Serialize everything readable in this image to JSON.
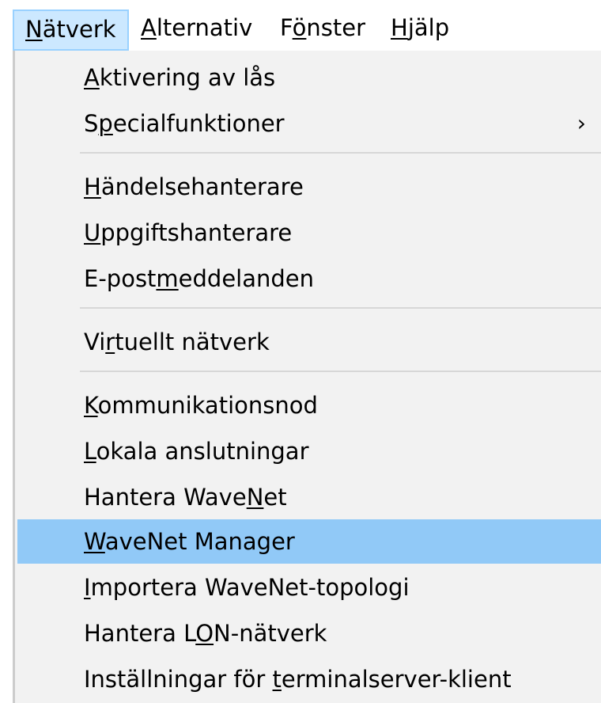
{
  "menubar": {
    "items": [
      {
        "pre": "",
        "key": "N",
        "post": "ätverk"
      },
      {
        "pre": "",
        "key": "A",
        "post": "lternativ"
      },
      {
        "pre": "F",
        "key": "ö",
        "post": "nster"
      },
      {
        "pre": "",
        "key": "H",
        "post": "jälp"
      }
    ]
  },
  "menu": {
    "items": [
      {
        "pre": "",
        "key": "A",
        "post": "ktivering av lås"
      },
      {
        "pre": "S",
        "key": "p",
        "post": "ecialfunktioner",
        "submenu": "›"
      },
      {
        "pre": "",
        "key": "H",
        "post": "ändelsehanterare"
      },
      {
        "pre": "",
        "key": "U",
        "post": "ppgiftshanterare"
      },
      {
        "pre": "E-post",
        "key": "m",
        "post": "eddelanden"
      },
      {
        "pre": "Vi",
        "key": "r",
        "post": "tuellt nätverk"
      },
      {
        "pre": "",
        "key": "K",
        "post": "ommunikationsnod"
      },
      {
        "pre": "",
        "key": "L",
        "post": "okala anslutningar"
      },
      {
        "pre": "Hantera Wave",
        "key": "N",
        "post": "et"
      },
      {
        "pre": "",
        "key": "W",
        "post": "aveNet Manager"
      },
      {
        "pre": "",
        "key": "I",
        "post": "mportera WaveNet-topologi"
      },
      {
        "pre": "Hantera L",
        "key": "O",
        "post": "N-nätverk"
      },
      {
        "pre": "Inställningar för ",
        "key": "t",
        "post": "erminalserver-klient"
      }
    ]
  }
}
